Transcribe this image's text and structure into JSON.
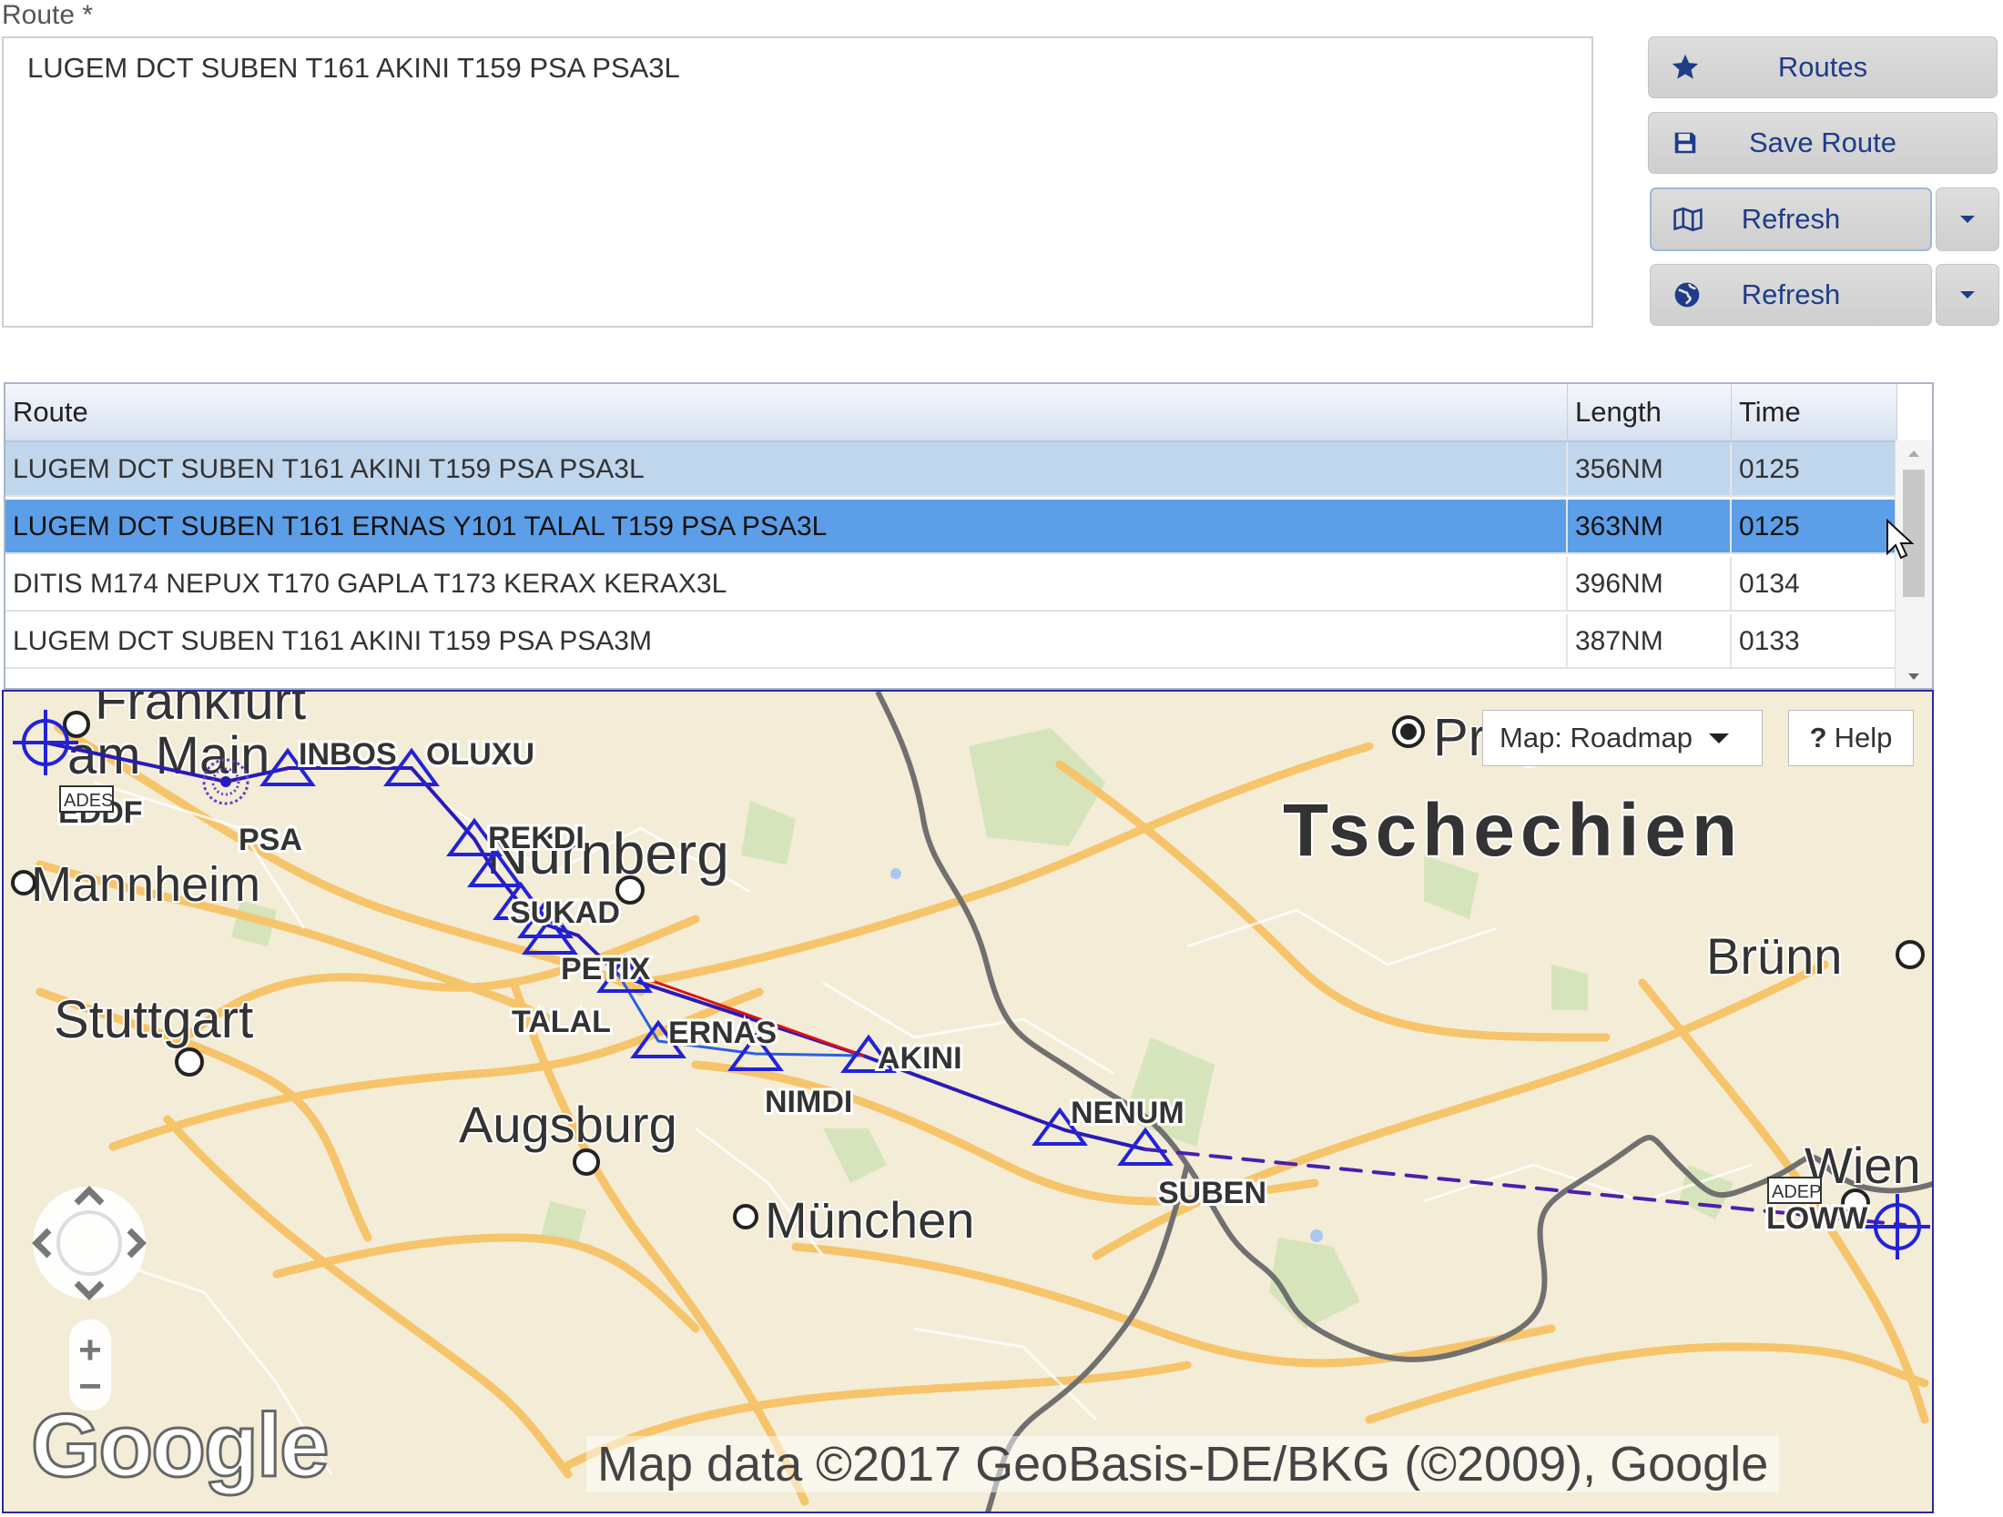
{
  "route_field": {
    "label": "Route *",
    "value": "LUGEM DCT SUBEN T161 AKINI T159 PSA PSA3L"
  },
  "buttons": {
    "routes": "Routes",
    "save_route": "Save Route",
    "refresh_map": "Refresh",
    "refresh_globe": "Refresh"
  },
  "icons": {
    "routes": "star-icon",
    "save_route": "floppy-disk-icon",
    "refresh_map": "map-icon",
    "refresh_globe": "globe-icon",
    "dropdown": "caret-down-icon"
  },
  "grid": {
    "columns": [
      "Route",
      "Length",
      "Time"
    ],
    "rows": [
      {
        "route": "LUGEM DCT SUBEN T161 AKINI T159 PSA PSA3L",
        "length": "356NM",
        "time": "0125"
      },
      {
        "route": "LUGEM DCT SUBEN T161 ERNAS Y101 TALAL T159 PSA PSA3L",
        "length": "363NM",
        "time": "0125"
      },
      {
        "route": "DITIS M174 NEPUX T170 GAPLA T173 KERAX KERAX3L",
        "length": "396NM",
        "time": "0134"
      },
      {
        "route": "LUGEM DCT SUBEN T161 AKINI T159 PSA PSA3M",
        "length": "387NM",
        "time": "0133"
      }
    ],
    "selected_row": 1
  },
  "map": {
    "type_button": "Map:  Roadmap",
    "help_button": "Help",
    "help_mark": "?",
    "attribution": "Map data ©2017 GeoBasis-DE/BKG (©2009), Google",
    "logo": "Google",
    "zoom_in": "+",
    "zoom_out": "−",
    "cities": [
      "Frankfurt",
      "am Main",
      "Mannheim",
      "Nürnberg",
      "Stuttgart",
      "Augsburg",
      "München",
      "Prag",
      "Tschechien",
      "Brünn",
      "Wien"
    ],
    "waypoints": [
      "INBOS",
      "OLUXU",
      "PSA",
      "EDDF",
      "REKDI",
      "SUKAD",
      "PETIX",
      "TALAL",
      "ERNAS",
      "AKINI",
      "NIMDI",
      "NENUM",
      "SUBEN",
      "LOWW"
    ],
    "airport_badges": {
      "ades": "ADES",
      "adep": "ADEP"
    },
    "colors": {
      "route_primary": "#2a1ab8",
      "route_alt": "#e01010",
      "route_dashed": "#4b1fb0",
      "road": "#f6c46a",
      "border": "#6f6f6f"
    }
  }
}
